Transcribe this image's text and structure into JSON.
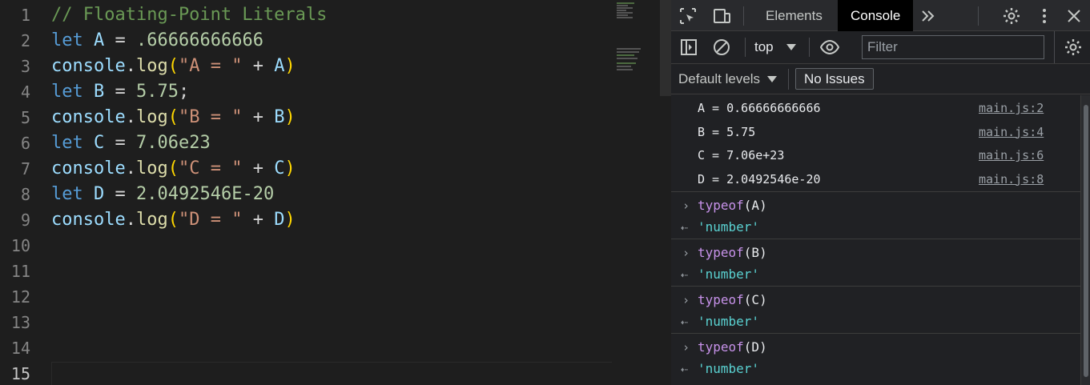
{
  "editor": {
    "lines": [
      {
        "n": "1",
        "tokens": [
          {
            "t": "// Floating-Point Literals",
            "c": "cmt"
          }
        ]
      },
      {
        "n": "2",
        "tokens": [
          {
            "t": "let",
            "c": "kw"
          },
          {
            "t": " ",
            "c": "op"
          },
          {
            "t": "A",
            "c": "var"
          },
          {
            "t": " = ",
            "c": "op"
          },
          {
            "t": ".66666666666",
            "c": "num"
          }
        ]
      },
      {
        "n": "3",
        "tokens": [
          {
            "t": "console",
            "c": "var"
          },
          {
            "t": ".",
            "c": "op"
          },
          {
            "t": "log",
            "c": "fn"
          },
          {
            "t": "(",
            "c": "paren"
          },
          {
            "t": "\"A = \"",
            "c": "str"
          },
          {
            "t": " + ",
            "c": "op"
          },
          {
            "t": "A",
            "c": "var"
          },
          {
            "t": ")",
            "c": "paren"
          }
        ]
      },
      {
        "n": "4",
        "tokens": [
          {
            "t": "let",
            "c": "kw"
          },
          {
            "t": " ",
            "c": "op"
          },
          {
            "t": "B",
            "c": "var"
          },
          {
            "t": " = ",
            "c": "op"
          },
          {
            "t": "5.75",
            "c": "num"
          },
          {
            "t": ";",
            "c": "op"
          }
        ]
      },
      {
        "n": "5",
        "tokens": [
          {
            "t": "console",
            "c": "var"
          },
          {
            "t": ".",
            "c": "op"
          },
          {
            "t": "log",
            "c": "fn"
          },
          {
            "t": "(",
            "c": "paren"
          },
          {
            "t": "\"B = \"",
            "c": "str"
          },
          {
            "t": " + ",
            "c": "op"
          },
          {
            "t": "B",
            "c": "var"
          },
          {
            "t": ")",
            "c": "paren"
          }
        ]
      },
      {
        "n": "6",
        "tokens": [
          {
            "t": "let",
            "c": "kw"
          },
          {
            "t": " ",
            "c": "op"
          },
          {
            "t": "C",
            "c": "var"
          },
          {
            "t": " = ",
            "c": "op"
          },
          {
            "t": "7.06e23",
            "c": "num"
          }
        ]
      },
      {
        "n": "7",
        "tokens": [
          {
            "t": "console",
            "c": "var"
          },
          {
            "t": ".",
            "c": "op"
          },
          {
            "t": "log",
            "c": "fn"
          },
          {
            "t": "(",
            "c": "paren"
          },
          {
            "t": "\"C = \"",
            "c": "str"
          },
          {
            "t": " + ",
            "c": "op"
          },
          {
            "t": "C",
            "c": "var"
          },
          {
            "t": ")",
            "c": "paren"
          }
        ]
      },
      {
        "n": "8",
        "tokens": [
          {
            "t": "let",
            "c": "kw"
          },
          {
            "t": " ",
            "c": "op"
          },
          {
            "t": "D",
            "c": "var"
          },
          {
            "t": " = ",
            "c": "op"
          },
          {
            "t": "2.0492546E-20",
            "c": "num"
          }
        ]
      },
      {
        "n": "9",
        "tokens": [
          {
            "t": "console",
            "c": "var"
          },
          {
            "t": ".",
            "c": "op"
          },
          {
            "t": "log",
            "c": "fn"
          },
          {
            "t": "(",
            "c": "paren"
          },
          {
            "t": "\"D = \"",
            "c": "str"
          },
          {
            "t": " + ",
            "c": "op"
          },
          {
            "t": "D",
            "c": "var"
          },
          {
            "t": ")",
            "c": "paren"
          }
        ]
      },
      {
        "n": "10",
        "tokens": []
      },
      {
        "n": "11",
        "tokens": []
      },
      {
        "n": "12",
        "tokens": []
      },
      {
        "n": "13",
        "tokens": []
      },
      {
        "n": "14",
        "tokens": []
      },
      {
        "n": "15",
        "tokens": []
      }
    ],
    "active_line": "15"
  },
  "devtools": {
    "tabs": {
      "elements": "Elements",
      "console": "Console"
    },
    "context": "top",
    "filter_placeholder": "Filter",
    "levels": "Default levels",
    "issues": "No Issues",
    "logs": [
      {
        "text": "A = 0.66666666666",
        "source": "main.js:2"
      },
      {
        "text": "B = 5.75",
        "source": "main.js:4"
      },
      {
        "text": "C = 7.06e+23",
        "source": "main.js:6"
      },
      {
        "text": "D = 2.0492546e-20",
        "source": "main.js:8"
      }
    ],
    "evals": [
      {
        "fn": "typeof",
        "arg": "(A)",
        "result": "'number'"
      },
      {
        "fn": "typeof",
        "arg": "(B)",
        "result": "'number'"
      },
      {
        "fn": "typeof",
        "arg": "(C)",
        "result": "'number'"
      },
      {
        "fn": "typeof",
        "arg": "(D)",
        "result": "'number'"
      }
    ]
  }
}
